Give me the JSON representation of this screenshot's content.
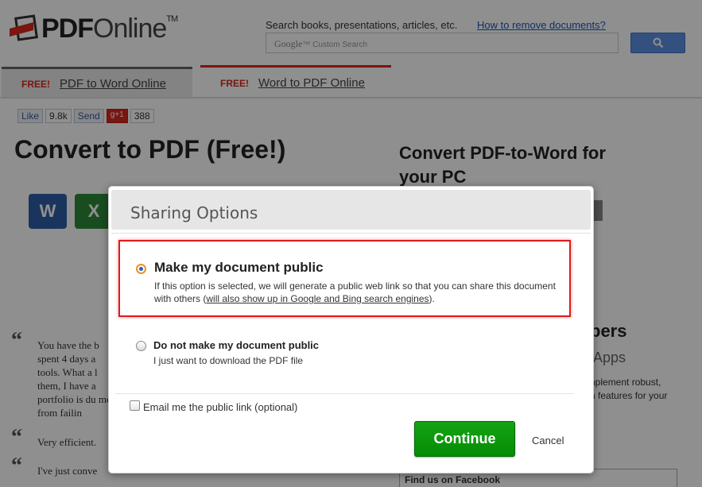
{
  "header": {
    "logo_pdf": "PDF",
    "logo_online": "Online",
    "logo_tm": "TM",
    "search_hint": "Search books, presentations, articles, etc.",
    "remove_link": "How to remove documents?",
    "search_placeholder_brand": "Google",
    "search_placeholder_tm": "™",
    "search_placeholder_text": " Custom Search"
  },
  "tabs": [
    {
      "free": "FREE!",
      "label": "PDF to Word Online"
    },
    {
      "free": "FREE!",
      "label": "Word to PDF Online"
    }
  ],
  "social": {
    "like": "Like",
    "like_count": "9.8k",
    "send": "Send",
    "gplus": "g+1",
    "gplus_count": "388"
  },
  "page": {
    "title": "Convert to PDF (Free!)",
    "side_title": "Convert PDF-to-Word for your PC",
    "side_heading": "pers",
    "side_apps": "Apps",
    "side_text1": "nplement robust,",
    "side_text2": "n features for your",
    "fb_box": "Find us on Facebook"
  },
  "quotes": [
    {
      "text": "You have the b spent 4 days a tools. What a l them, I have a portfolio is du me from failin"
    },
    {
      "text": "Very efficient."
    },
    {
      "text": "I've just conve"
    }
  ],
  "modal": {
    "title": "Sharing Options",
    "option_public_title": "Make my document public",
    "option_public_desc_a": "If this option is selected, we will generate a public web link so that you can share this document with others (",
    "option_public_desc_link": "will also show up in Google and Bing search engines",
    "option_public_desc_b": ").",
    "option_private_title": "Do not make my document public",
    "option_private_desc": "I just want to download the PDF file",
    "email_label": "Email me the public link (optional)",
    "continue_label": "Continue",
    "cancel_label": "Cancel"
  },
  "colors": {
    "accent_red": "#d9261c",
    "continue_green": "#0a960a",
    "link_blue": "#1a55b8",
    "highlight_red": "#e01a1a"
  }
}
